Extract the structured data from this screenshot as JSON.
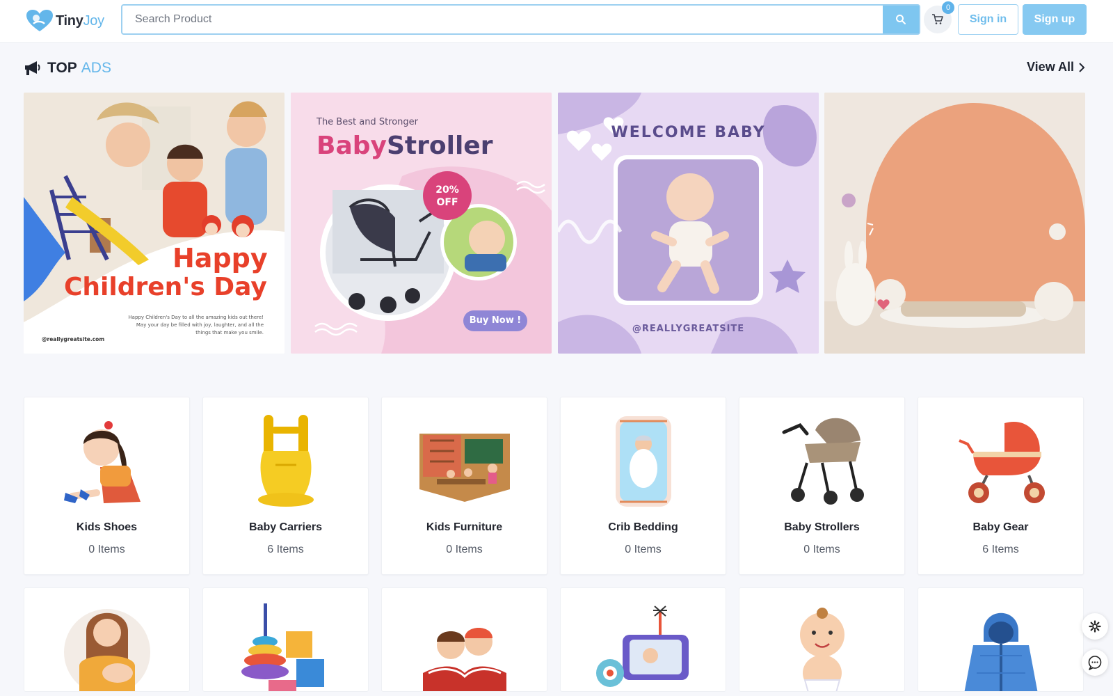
{
  "brand": {
    "name_part1": "Tiny",
    "name_part2": "Joy"
  },
  "search": {
    "placeholder": "Search Product"
  },
  "cart": {
    "count": "0"
  },
  "auth": {
    "signin_label": "Sign in",
    "signup_label": "Sign up"
  },
  "top_ads": {
    "title_part1": "TOP",
    "title_part2": "ADS",
    "view_all": "View All",
    "ads": [
      {
        "headline1": "Happy",
        "headline2": "Children's Day",
        "body": "Happy Children's Day to all the amazing kids out there! May your day be filled with joy, laughter, and all the things that make you smile.",
        "handle": "@reallygreatsite.com"
      },
      {
        "kicker": "The Best and Stronger",
        "title1": "Baby",
        "title2": "Stroller",
        "badge_line1": "20%",
        "badge_line2": "OFF",
        "cta": "Buy Now !"
      },
      {
        "title": "WELCOME BABY",
        "handle": "@REALLYGREATSITE"
      },
      {}
    ]
  },
  "categories": [
    {
      "name": "Kids Shoes",
      "count": "0 Items",
      "icon": "girl-tying-shoes"
    },
    {
      "name": "Baby Carriers",
      "count": "6 Items",
      "icon": "baby-carrier"
    },
    {
      "name": "Kids Furniture",
      "count": "0 Items",
      "icon": "classroom"
    },
    {
      "name": "Crib Bedding",
      "count": "0 Items",
      "icon": "baby-in-crib"
    },
    {
      "name": "Baby Strollers",
      "count": "0 Items",
      "icon": "stroller"
    },
    {
      "name": "Baby Gear",
      "count": "6 Items",
      "icon": "pram"
    }
  ],
  "categories_row2": [
    {
      "icon": "mother-feeding-baby"
    },
    {
      "icon": "stacking-toys"
    },
    {
      "icon": "kids-reading-book"
    },
    {
      "icon": "baby-monitor"
    },
    {
      "icon": "baby-in-diaper"
    },
    {
      "icon": "hooded-jacket"
    }
  ],
  "colors": {
    "accent": "#63b6ea",
    "button": "#86c9f1"
  }
}
